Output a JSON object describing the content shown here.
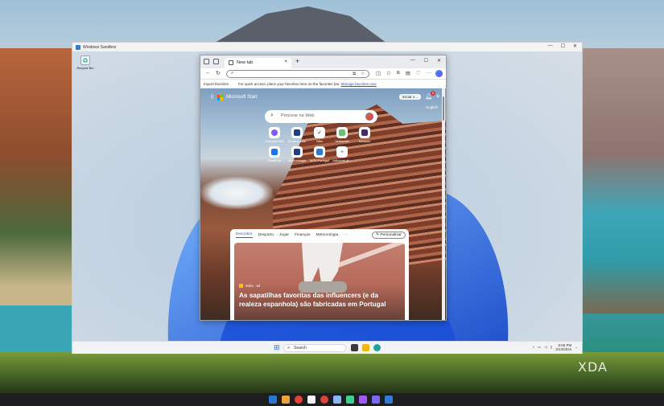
{
  "sandbox": {
    "title": "Windows Sandbox",
    "controls": [
      "—",
      "☐",
      "✕"
    ],
    "recycle_label": "Recycle Bin",
    "taskbar": {
      "search_placeholder": "Search",
      "clock_time": "8:05 PM",
      "clock_date": "3/13/2024"
    }
  },
  "browser": {
    "tab_title": "New tab",
    "new_tab": "+",
    "window_controls": [
      "—",
      "☐",
      "✕"
    ],
    "favorites_bar": {
      "import": "Import favorites",
      "hint": "For quick access, place your favorites here on the favorites bar.",
      "manage": "Manage favorites now"
    },
    "newtab_page": {
      "brand": "Microsoft Start",
      "signin": "Iniciar s...",
      "notifications": "5",
      "language": "English",
      "search_placeholder": "Procurar na Web",
      "tiles": [
        {
          "label": "Microsoft 365",
          "color": "#7a5cff"
        },
        {
          "label": "Booking.com",
          "color": "#1b3f8a"
        },
        {
          "label": "Nike",
          "color": "#111111"
        },
        {
          "label": "Verbaudet",
          "color": "#6cc070"
        },
        {
          "label": "Montorio",
          "color": "#4a2a6a"
        },
        {
          "label": "Facebook",
          "color": "#1877f2"
        },
        {
          "label": "Meteorologia",
          "color": "#1b3f8a"
        },
        {
          "label": "MSN Portugal",
          "color": "#2a7ad6"
        },
        {
          "label": "Adicionar at...",
          "color": "#888888"
        }
      ],
      "feed_tabs": [
        "Descobrir",
        "Desporto",
        "Jogar",
        "Finanças",
        "Meteorologia",
        "···"
      ],
      "personalize": "Personalizar",
      "story": {
        "source": "Sofia · 3d",
        "headline": "As sapatilhas favoritas das influencers (e da realeza espanhola) são fabricadas em Portugal"
      }
    }
  },
  "watermark": "XDA",
  "colors": {
    "accent": "#2b5fd6",
    "windows_blue": "#2b76d2"
  }
}
